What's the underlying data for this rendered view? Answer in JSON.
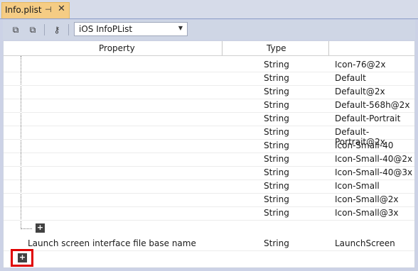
{
  "tab": {
    "title": "Info.plist",
    "pin_icon": "pin-icon",
    "close_icon": "close-icon"
  },
  "toolbar": {
    "icons": [
      "expand-all-icon",
      "collapse-all-icon",
      "key-icon"
    ],
    "dropdown_value": "iOS InfoPList"
  },
  "columns": {
    "property": "Property",
    "type": "Type"
  },
  "rows": [
    {
      "type": "String",
      "value": "Icon-76@2x"
    },
    {
      "type": "String",
      "value": "Default"
    },
    {
      "type": "String",
      "value": "Default@2x"
    },
    {
      "type": "String",
      "value": "Default-568h@2x"
    },
    {
      "type": "String",
      "value": "Default-Portrait"
    },
    {
      "type": "String",
      "value": "Default-Portrait@2x"
    },
    {
      "type": "String",
      "value": "Icon-Small-40"
    },
    {
      "type": "String",
      "value": "Icon-Small-40@2x"
    },
    {
      "type": "String",
      "value": "Icon-Small-40@3x"
    },
    {
      "type": "String",
      "value": "Icon-Small"
    },
    {
      "type": "String",
      "value": "Icon-Small@2x"
    },
    {
      "type": "String",
      "value": "Icon-Small@3x"
    }
  ],
  "launch_row": {
    "name": "Launch screen interface file base name",
    "type": "String",
    "value": "LaunchScreen"
  },
  "colors": {
    "highlight": "#e00000",
    "tab_active": "#f5cc84"
  }
}
